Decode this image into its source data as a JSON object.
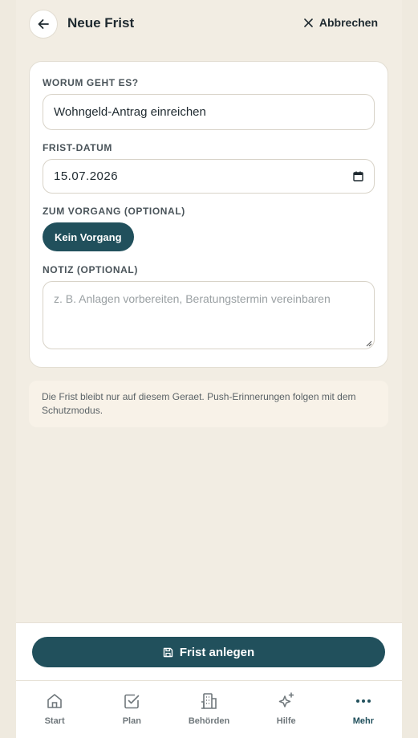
{
  "header": {
    "title": "Neue Frist",
    "cancel_label": "Abbrechen"
  },
  "form": {
    "topic_label": "WORUM GEHT ES?",
    "topic_value": "Wohngeld-Antrag einreichen",
    "date_label": "FRIST-DATUM",
    "date_value": "15.07.2026",
    "case_label": "ZUM VORGANG (OPTIONAL)",
    "case_chip": "Kein Vorgang",
    "note_label": "NOTIZ (OPTIONAL)",
    "note_placeholder": "z. B. Anlagen vorbereiten, Beratungstermin vereinbaren"
  },
  "info": {
    "text": "Die Frist bleibt nur auf diesem Geraet. Push-Erinnerungen folgen mit dem Schutzmodus."
  },
  "action": {
    "submit_label": "Frist anlegen"
  },
  "nav": {
    "items": [
      {
        "label": "Start",
        "icon": "home-icon"
      },
      {
        "label": "Plan",
        "icon": "checkbox-icon"
      },
      {
        "label": "Behörden",
        "icon": "building-icon"
      },
      {
        "label": "Hilfe",
        "icon": "sparkle-icon"
      },
      {
        "label": "Mehr",
        "icon": "more-icon",
        "active": true
      }
    ]
  },
  "colors": {
    "accent": "#21505c",
    "background": "#efeadf"
  }
}
